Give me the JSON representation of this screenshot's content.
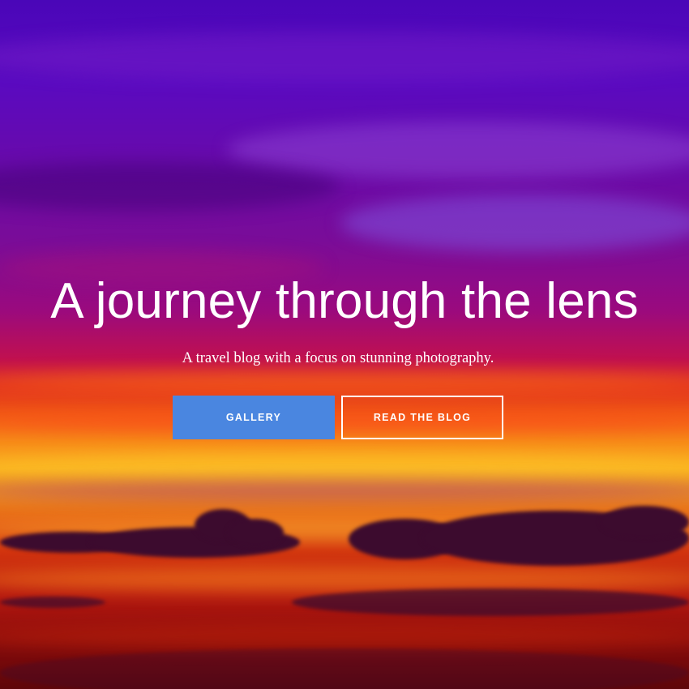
{
  "hero": {
    "headline": "A journey through the lens",
    "subtitle": "A travel blog with a focus on stunning photography.",
    "background_image": "sunset sky with purple clouds and orange horizon"
  },
  "buttons": {
    "gallery_label": "GALLERY",
    "read_blog_label": "READ THE BLOG"
  },
  "colors": {
    "gallery_button": "#4a86e0",
    "text": "#ffffff",
    "outline_button_border": "#ffffff"
  }
}
